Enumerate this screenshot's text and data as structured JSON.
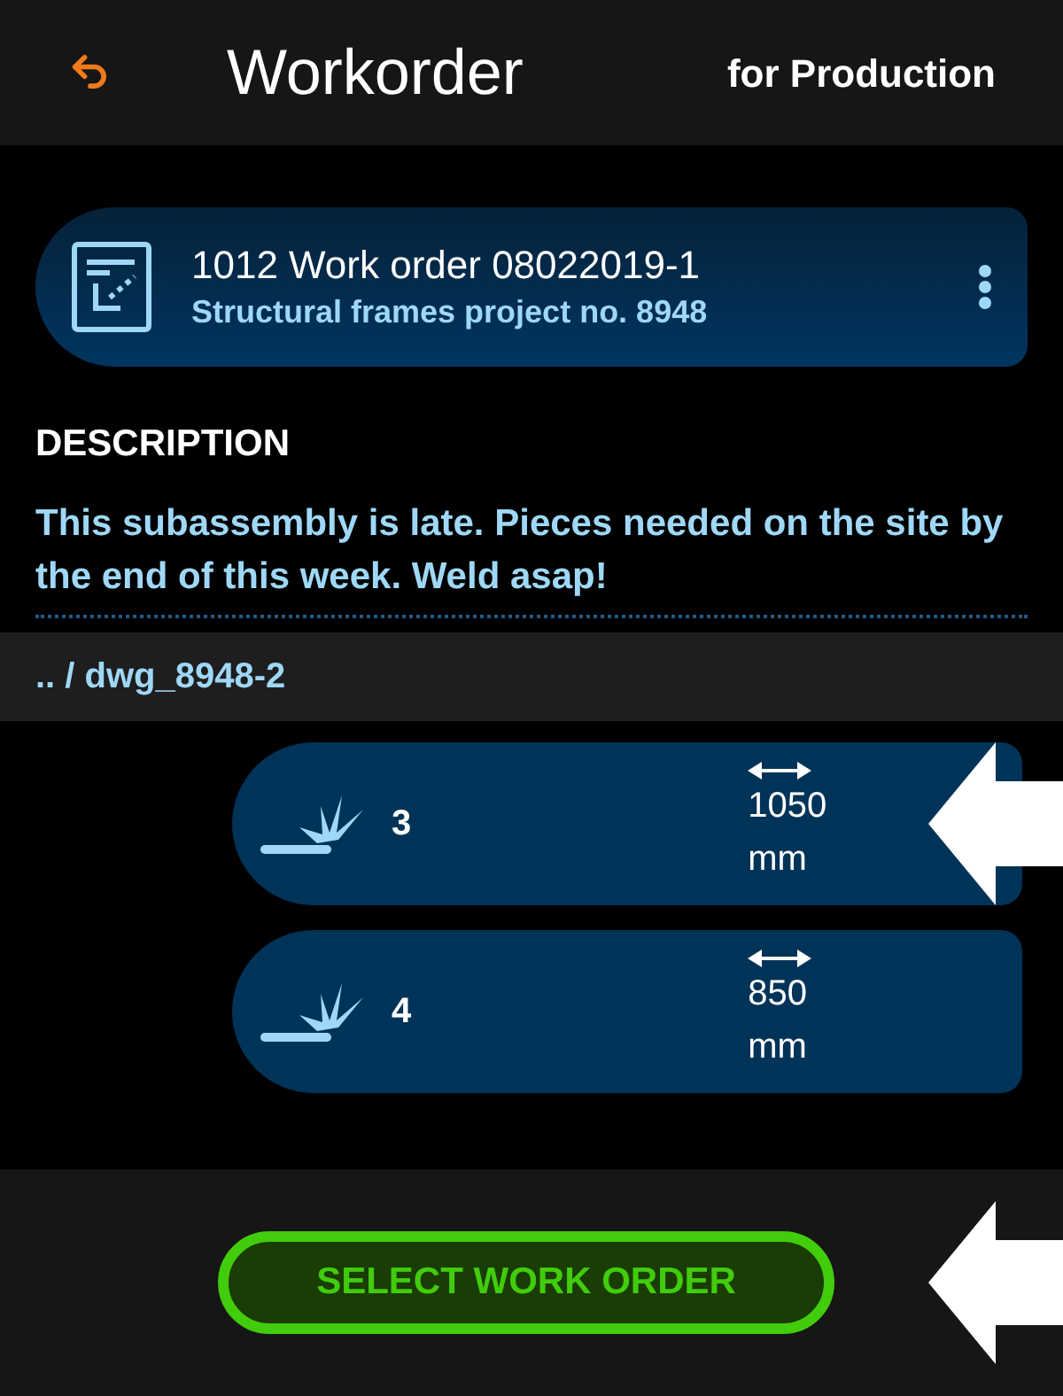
{
  "header": {
    "title": "Workorder",
    "subtitle": "for Production"
  },
  "work_order": {
    "title": "1012 Work order 08022019-1",
    "project": "Structural frames project no. 8948"
  },
  "description": {
    "heading": "DESCRIPTION",
    "text": "This subassembly is late. Pieces needed on the site by the end of this week. Weld asap!"
  },
  "breadcrumb": ".. / dwg_8948-2",
  "welds": [
    {
      "count": "3",
      "length": "1050",
      "unit": "mm",
      "pointer": true
    },
    {
      "count": "4",
      "length": "850",
      "unit": "mm",
      "pointer": false
    }
  ],
  "footer": {
    "button": "SELECT WORK ORDER",
    "pointer": true
  }
}
